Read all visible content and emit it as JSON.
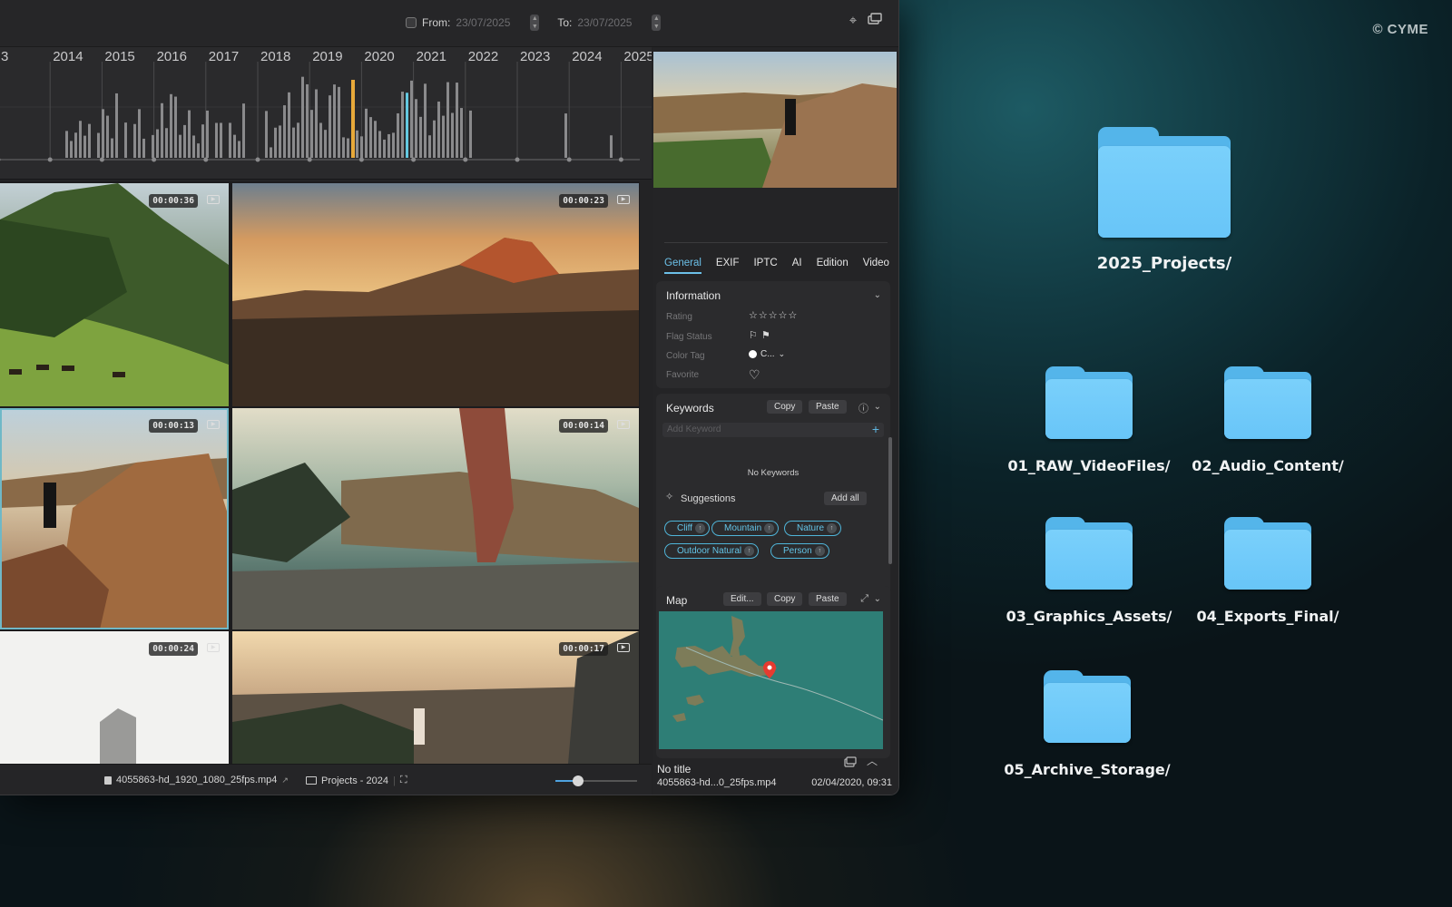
{
  "watermark": "© CYME",
  "desktop": {
    "folders": [
      {
        "name": "2025_Projects/"
      },
      {
        "name": "01_RAW_VideoFiles/"
      },
      {
        "name": "02_Audio_Content/"
      },
      {
        "name": "03_Graphics_Assets/"
      },
      {
        "name": "04_Exports_Final/"
      },
      {
        "name": "05_Archive_Storage/"
      }
    ]
  },
  "toolbar": {
    "from_label": "From:",
    "from_value": "23/07/2025",
    "to_label": "To:",
    "to_value": "23/07/2025",
    "locate_icon": "crosshair-icon",
    "window_icon": "windows-icon"
  },
  "timeline": {
    "years": [
      "3",
      "2014",
      "2015",
      "2016",
      "2017",
      "2018",
      "2019",
      "2020",
      "2021",
      "2022",
      "2023",
      "2024",
      "2025"
    ],
    "highlight_colors": {
      "selected": "#e8a93a",
      "current": "#63c8e0",
      "bar": "#8a8a8c"
    }
  },
  "grid": {
    "thumbs": [
      {
        "duration": "00:00:36"
      },
      {
        "duration": "00:00:23"
      },
      {
        "duration": "00:00:13"
      },
      {
        "duration": "00:00:14"
      },
      {
        "duration": "00:00:24"
      },
      {
        "duration": "00:00:17"
      }
    ]
  },
  "statusbar": {
    "filename": "4055863-hd_1920_1080_25fps.mp4",
    "folder": "Projects - 2024",
    "zoom_level": 0.28
  },
  "inspector": {
    "tabs": [
      "General",
      "EXIF",
      "IPTC",
      "AI",
      "Edition",
      "Video"
    ],
    "active_tab": "General",
    "information": {
      "title": "Information",
      "rating_label": "Rating",
      "rating_value": "☆☆☆☆☆",
      "flag_label": "Flag Status",
      "color_label": "Color Tag",
      "color_value": "C...",
      "favorite_label": "Favorite"
    },
    "keywords": {
      "title": "Keywords",
      "copy": "Copy",
      "paste": "Paste",
      "placeholder": "Add Keyword",
      "empty": "No Keywords",
      "suggestions_label": "Suggestions",
      "add_all": "Add all",
      "suggestions": [
        "Cliff",
        "Mountain",
        "Nature",
        "Outdoor Natural",
        "Person"
      ]
    },
    "map": {
      "title": "Map",
      "edit": "Edit...",
      "copy": "Copy",
      "paste": "Paste"
    },
    "footer": {
      "title": "No title",
      "file": "4055863-hd...0_25fps.mp4",
      "date": "02/04/2020, 09:31"
    }
  }
}
